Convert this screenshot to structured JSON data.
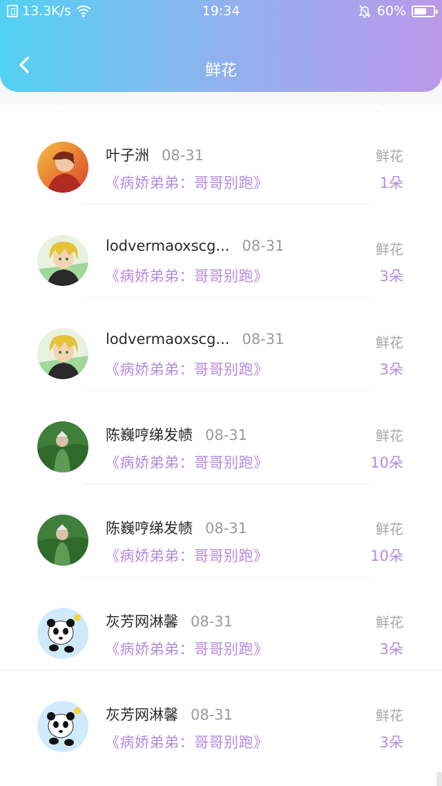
{
  "status_bar": {
    "network_speed": "13.3K/s",
    "time": "19:34",
    "battery_percent": "60%"
  },
  "header": {
    "title": "鲜花"
  },
  "records": [
    {
      "name": "叶子洲",
      "date": "08-31",
      "book": "《病娇弟弟：哥哥别跑》",
      "gift_type": "鲜花",
      "count": "1朵",
      "avatar": "avatar-red-anime"
    },
    {
      "name": "lodvermaoxscg...",
      "date": "08-31",
      "book": "《病娇弟弟：哥哥别跑》",
      "gift_type": "鲜花",
      "count": "3朵",
      "avatar": "avatar-blond-anime"
    },
    {
      "name": "lodvermaoxscg...",
      "date": "08-31",
      "book": "《病娇弟弟：哥哥别跑》",
      "gift_type": "鲜花",
      "count": "3朵",
      "avatar": "avatar-blond-anime"
    },
    {
      "name": "陈巍哼绨发帻",
      "date": "08-31",
      "book": "《病娇弟弟：哥哥别跑》",
      "gift_type": "鲜花",
      "count": "10朵",
      "avatar": "avatar-grass-photo"
    },
    {
      "name": "陈巍哼绨发帻",
      "date": "08-31",
      "book": "《病娇弟弟：哥哥别跑》",
      "gift_type": "鲜花",
      "count": "10朵",
      "avatar": "avatar-grass-photo"
    },
    {
      "name": "灰芳网淋馨",
      "date": "08-31",
      "book": "《病娇弟弟：哥哥别跑》",
      "gift_type": "鲜花",
      "count": "3朵",
      "avatar": "avatar-panda"
    },
    {
      "name": "灰芳网淋馨",
      "date": "08-31",
      "book": "《病娇弟弟：哥哥别跑》",
      "gift_type": "鲜花",
      "count": "3朵",
      "avatar": "avatar-panda"
    }
  ],
  "colors": {
    "header_gradient": [
      "#52d1f3",
      "#8fb2ee",
      "#bb98e9"
    ],
    "accent_purple": "#b48ae0",
    "name_text": "#2a2a2a",
    "muted_text": "#9a9a9a"
  }
}
